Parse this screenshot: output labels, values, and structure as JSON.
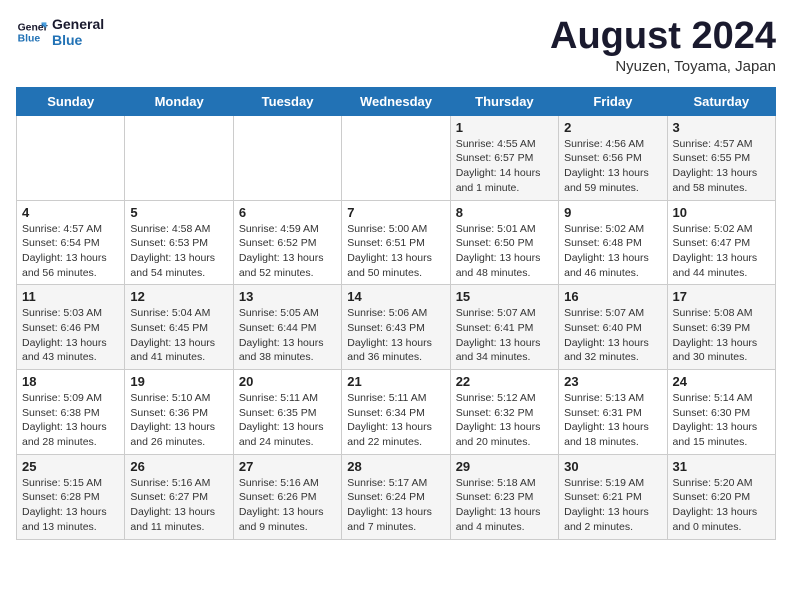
{
  "logo": {
    "line1": "General",
    "line2": "Blue"
  },
  "title": "August 2024",
  "location": "Nyuzen, Toyama, Japan",
  "days_of_week": [
    "Sunday",
    "Monday",
    "Tuesday",
    "Wednesday",
    "Thursday",
    "Friday",
    "Saturday"
  ],
  "weeks": [
    [
      {
        "day": "",
        "content": ""
      },
      {
        "day": "",
        "content": ""
      },
      {
        "day": "",
        "content": ""
      },
      {
        "day": "",
        "content": ""
      },
      {
        "day": "1",
        "content": "Sunrise: 4:55 AM\nSunset: 6:57 PM\nDaylight: 14 hours\nand 1 minute."
      },
      {
        "day": "2",
        "content": "Sunrise: 4:56 AM\nSunset: 6:56 PM\nDaylight: 13 hours\nand 59 minutes."
      },
      {
        "day": "3",
        "content": "Sunrise: 4:57 AM\nSunset: 6:55 PM\nDaylight: 13 hours\nand 58 minutes."
      }
    ],
    [
      {
        "day": "4",
        "content": "Sunrise: 4:57 AM\nSunset: 6:54 PM\nDaylight: 13 hours\nand 56 minutes."
      },
      {
        "day": "5",
        "content": "Sunrise: 4:58 AM\nSunset: 6:53 PM\nDaylight: 13 hours\nand 54 minutes."
      },
      {
        "day": "6",
        "content": "Sunrise: 4:59 AM\nSunset: 6:52 PM\nDaylight: 13 hours\nand 52 minutes."
      },
      {
        "day": "7",
        "content": "Sunrise: 5:00 AM\nSunset: 6:51 PM\nDaylight: 13 hours\nand 50 minutes."
      },
      {
        "day": "8",
        "content": "Sunrise: 5:01 AM\nSunset: 6:50 PM\nDaylight: 13 hours\nand 48 minutes."
      },
      {
        "day": "9",
        "content": "Sunrise: 5:02 AM\nSunset: 6:48 PM\nDaylight: 13 hours\nand 46 minutes."
      },
      {
        "day": "10",
        "content": "Sunrise: 5:02 AM\nSunset: 6:47 PM\nDaylight: 13 hours\nand 44 minutes."
      }
    ],
    [
      {
        "day": "11",
        "content": "Sunrise: 5:03 AM\nSunset: 6:46 PM\nDaylight: 13 hours\nand 43 minutes."
      },
      {
        "day": "12",
        "content": "Sunrise: 5:04 AM\nSunset: 6:45 PM\nDaylight: 13 hours\nand 41 minutes."
      },
      {
        "day": "13",
        "content": "Sunrise: 5:05 AM\nSunset: 6:44 PM\nDaylight: 13 hours\nand 38 minutes."
      },
      {
        "day": "14",
        "content": "Sunrise: 5:06 AM\nSunset: 6:43 PM\nDaylight: 13 hours\nand 36 minutes."
      },
      {
        "day": "15",
        "content": "Sunrise: 5:07 AM\nSunset: 6:41 PM\nDaylight: 13 hours\nand 34 minutes."
      },
      {
        "day": "16",
        "content": "Sunrise: 5:07 AM\nSunset: 6:40 PM\nDaylight: 13 hours\nand 32 minutes."
      },
      {
        "day": "17",
        "content": "Sunrise: 5:08 AM\nSunset: 6:39 PM\nDaylight: 13 hours\nand 30 minutes."
      }
    ],
    [
      {
        "day": "18",
        "content": "Sunrise: 5:09 AM\nSunset: 6:38 PM\nDaylight: 13 hours\nand 28 minutes."
      },
      {
        "day": "19",
        "content": "Sunrise: 5:10 AM\nSunset: 6:36 PM\nDaylight: 13 hours\nand 26 minutes."
      },
      {
        "day": "20",
        "content": "Sunrise: 5:11 AM\nSunset: 6:35 PM\nDaylight: 13 hours\nand 24 minutes."
      },
      {
        "day": "21",
        "content": "Sunrise: 5:11 AM\nSunset: 6:34 PM\nDaylight: 13 hours\nand 22 minutes."
      },
      {
        "day": "22",
        "content": "Sunrise: 5:12 AM\nSunset: 6:32 PM\nDaylight: 13 hours\nand 20 minutes."
      },
      {
        "day": "23",
        "content": "Sunrise: 5:13 AM\nSunset: 6:31 PM\nDaylight: 13 hours\nand 18 minutes."
      },
      {
        "day": "24",
        "content": "Sunrise: 5:14 AM\nSunset: 6:30 PM\nDaylight: 13 hours\nand 15 minutes."
      }
    ],
    [
      {
        "day": "25",
        "content": "Sunrise: 5:15 AM\nSunset: 6:28 PM\nDaylight: 13 hours\nand 13 minutes."
      },
      {
        "day": "26",
        "content": "Sunrise: 5:16 AM\nSunset: 6:27 PM\nDaylight: 13 hours\nand 11 minutes."
      },
      {
        "day": "27",
        "content": "Sunrise: 5:16 AM\nSunset: 6:26 PM\nDaylight: 13 hours\nand 9 minutes."
      },
      {
        "day": "28",
        "content": "Sunrise: 5:17 AM\nSunset: 6:24 PM\nDaylight: 13 hours\nand 7 minutes."
      },
      {
        "day": "29",
        "content": "Sunrise: 5:18 AM\nSunset: 6:23 PM\nDaylight: 13 hours\nand 4 minutes."
      },
      {
        "day": "30",
        "content": "Sunrise: 5:19 AM\nSunset: 6:21 PM\nDaylight: 13 hours\nand 2 minutes."
      },
      {
        "day": "31",
        "content": "Sunrise: 5:20 AM\nSunset: 6:20 PM\nDaylight: 13 hours\nand 0 minutes."
      }
    ]
  ]
}
